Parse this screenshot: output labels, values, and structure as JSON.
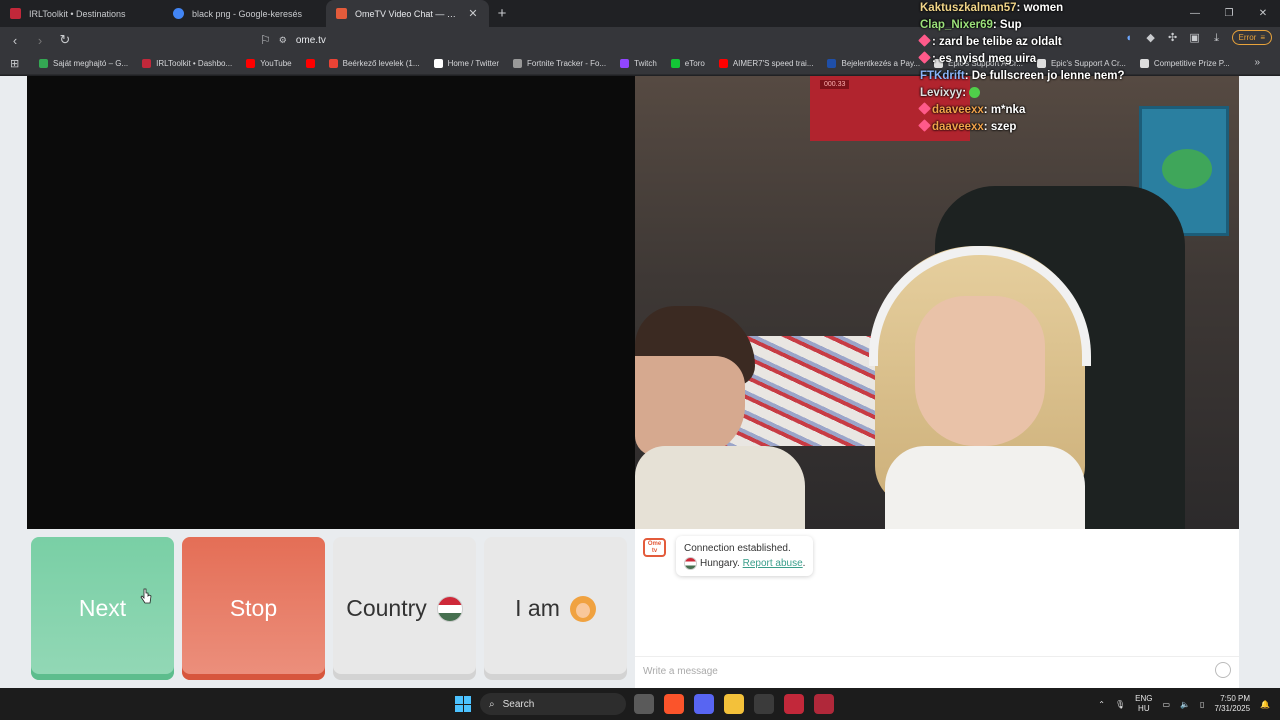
{
  "browser": {
    "tabs": [
      {
        "title": "IRLToolkit • Destinations",
        "icon": "irltoolkit-icon",
        "color": "#c2283a"
      },
      {
        "title": "black png - Google-keresés",
        "icon": "google-icon",
        "color": "#4285f4"
      },
      {
        "title": "OmeTV Video Chat — Omegle",
        "icon": "ometv-icon",
        "color": "#e35b3b",
        "active": true
      }
    ],
    "url": "ome.tv",
    "error_label": "Error",
    "bookmarks": [
      {
        "label": "Saját meghajtó – G...",
        "color": "#34a853"
      },
      {
        "label": "IRLToolkit • Dashbo...",
        "color": "#c2283a"
      },
      {
        "label": "YouTube",
        "color": "#ff0000"
      },
      {
        "label": "",
        "color": "#ff0000"
      },
      {
        "label": "Beérkező levelek (1...",
        "color": "#ea4335"
      },
      {
        "label": "Home / Twitter",
        "color": "#ffffff"
      },
      {
        "label": "Fortnite Tracker - Fo...",
        "color": "#999999"
      },
      {
        "label": "Twitch",
        "color": "#9146ff"
      },
      {
        "label": "eToro",
        "color": "#13c636"
      },
      {
        "label": "AIMER7'S speed trai...",
        "color": "#ff0000"
      },
      {
        "label": "Bejelentkezés a Pay...",
        "color": "#1f4fa8"
      },
      {
        "label": "Epic's Support A Cr...",
        "color": "#dddddd"
      },
      {
        "label": "Epic's Support A Cr...",
        "color": "#dddddd"
      },
      {
        "label": "Competitive Prize P...",
        "color": "#dddddd"
      }
    ]
  },
  "ometv": {
    "buttons": {
      "next": "Next",
      "stop": "Stop",
      "country": "Country",
      "i_am": "I am"
    },
    "chat": {
      "connection": "Connection established.",
      "country": "Hungary.",
      "report": "Report abuse",
      "report_suffix": ".",
      "placeholder": "Write a message"
    },
    "poster_label": "000.33"
  },
  "overlay_chat": [
    {
      "user": "Kaktuszkalman57",
      "text": "women",
      "color": "#f0d488",
      "badge": false
    },
    {
      "user": "Clap_Nixer69",
      "text": "Sup",
      "color": "#9be07a",
      "badge": false
    },
    {
      "user": "",
      "text": "zard be telibe az oldalt",
      "color": "#ff5a8a",
      "badge": true
    },
    {
      "user": "",
      "text": "es nyisd meg uira",
      "color": "#ff5a8a",
      "badge": true
    },
    {
      "user": "FTKdrift",
      "text": "De fullscreen jo lenne nem?",
      "color": "#8ab4f8",
      "badge": false
    },
    {
      "user": "Levixyy",
      "text": "",
      "color": "#e0e0e0",
      "badge": false,
      "emote": true
    },
    {
      "user": "daaveexx",
      "text": "m*nka",
      "color": "#f0a24a",
      "badge": true
    },
    {
      "user": "daaveexx",
      "text": "szep",
      "color": "#f0a24a",
      "badge": true
    }
  ],
  "taskbar": {
    "search_label": "Search",
    "lang_top": "ENG",
    "lang_bottom": "HU",
    "time": "7:50 PM",
    "date": "7/31/2025",
    "apps": [
      {
        "name": "task-view",
        "color": "#5a5a5a"
      },
      {
        "name": "brave",
        "color": "#fb542b"
      },
      {
        "name": "discord",
        "color": "#5865f2"
      },
      {
        "name": "file-explorer",
        "color": "#f3c13a"
      },
      {
        "name": "app-5",
        "color": "#3b3b3b"
      },
      {
        "name": "app-6",
        "color": "#c2283a"
      },
      {
        "name": "app-7",
        "color": "#b0283a"
      }
    ]
  }
}
